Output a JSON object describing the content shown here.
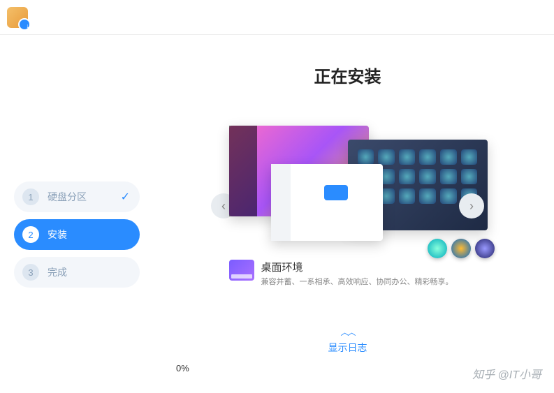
{
  "header": {
    "app_icon_name": "installer-icon"
  },
  "sidebar": {
    "steps": [
      {
        "num": "1",
        "label": "硬盘分区",
        "completed": true
      },
      {
        "num": "2",
        "label": "安装",
        "completed": false
      },
      {
        "num": "3",
        "label": "完成",
        "completed": false
      }
    ],
    "active_index": 1
  },
  "content": {
    "title": "正在安装",
    "carousel": {
      "prev_icon": "chevron-left-icon",
      "next_icon": "chevron-right-icon",
      "slide": {
        "caption_title": "桌面环境",
        "caption_desc": "兼容并蓄、一系相承、高效响应、协同办公、精彩畅享。"
      }
    },
    "show_log_label": "显示日志",
    "progress_text": "0%"
  },
  "watermark": "知乎 @IT小哥"
}
